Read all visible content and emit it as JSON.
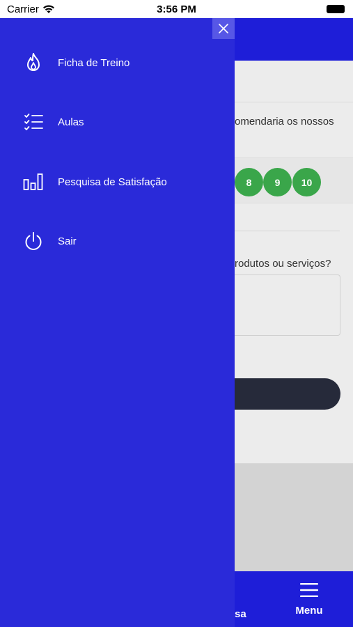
{
  "status_bar": {
    "carrier": "Carrier",
    "time": "3:56 PM"
  },
  "drawer": {
    "items": [
      {
        "label": "Ficha de Treino",
        "icon": "flame-icon"
      },
      {
        "label": "Aulas",
        "icon": "checklist-icon"
      },
      {
        "label": "Pesquisa de Satisfação",
        "icon": "bar-chart-icon"
      },
      {
        "label": "Sair",
        "icon": "power-icon"
      }
    ]
  },
  "background": {
    "question1_partial": "omendaria os nossos",
    "scores": [
      "8",
      "9",
      "10"
    ],
    "question2_partial": "rodutos ou serviços?",
    "tab_partial_label": "sa",
    "menu_label": "Menu"
  },
  "colors": {
    "drawer": "#2a2ad9",
    "header": "#1e1ed8",
    "score": "#3aa64a",
    "button": "#262a3a"
  }
}
